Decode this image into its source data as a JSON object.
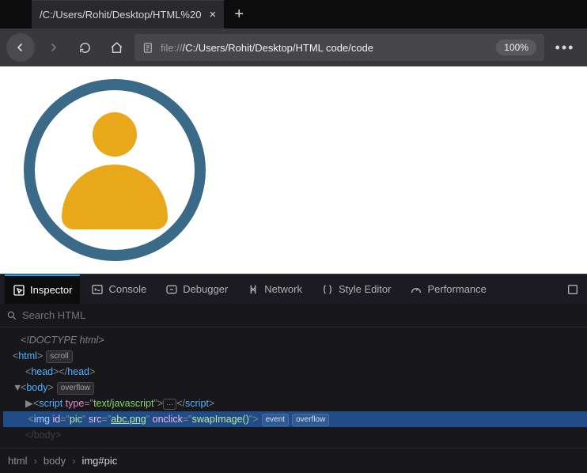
{
  "tab": {
    "title": "/C:/Users/Rohit/Desktop/HTML%20"
  },
  "toolbar": {
    "url_scheme": "file://",
    "url_path": "/C:/Users/Rohit/Desktop/HTML code/code",
    "zoom": "100%"
  },
  "devtools": {
    "tabs": {
      "inspector": "Inspector",
      "console": "Console",
      "debugger": "Debugger",
      "network": "Network",
      "style": "Style Editor",
      "performance": "Performance"
    },
    "search_placeholder": "Search HTML"
  },
  "markup": {
    "doctype": "<!DOCTYPE html>",
    "html_open": "html",
    "scroll_badge": "scroll",
    "head": "head",
    "body": "body",
    "overflow_badge": "overflow",
    "event_badge": "event",
    "script_type_attr": "type",
    "script_type_val": "text/javascript",
    "script_tag": "script",
    "img_tag": "img",
    "img_id_attr": "id",
    "img_id_val": "pic",
    "img_src_attr": "src",
    "img_src_val": "abc.png",
    "img_onclick_attr": "onclick",
    "img_onclick_val": "swapImage()"
  },
  "crumbs": {
    "a": "html",
    "b": "body",
    "c": "img#pic"
  }
}
